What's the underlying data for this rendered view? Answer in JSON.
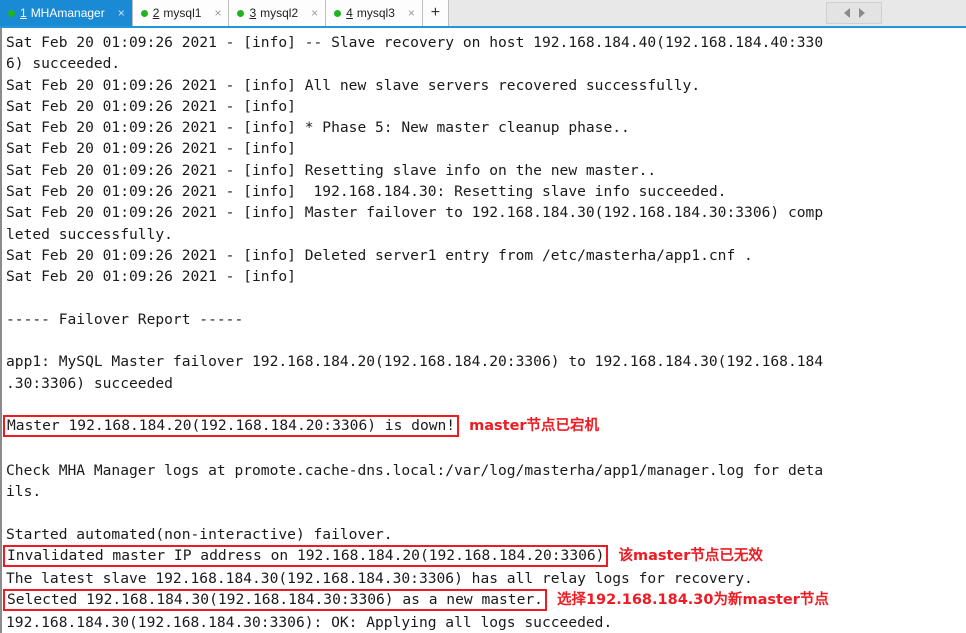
{
  "tabbar": {
    "tabs": [
      {
        "index": "1",
        "label": "MHAmanager",
        "status_color": "#22b321",
        "close": "×",
        "active": true
      },
      {
        "index": "2",
        "label": "mysql1",
        "status_color": "#22b321",
        "close": "×",
        "active": false
      },
      {
        "index": "3",
        "label": "mysql2",
        "status_color": "#22b321",
        "close": "×",
        "active": false
      },
      {
        "index": "4",
        "label": "mysql3",
        "status_color": "#22b321",
        "close": "×",
        "active": false
      }
    ],
    "new_tab_label": "+",
    "nav_prev": "◀",
    "nav_next": "▶"
  },
  "terminal": {
    "lines": [
      {
        "text": "Sat Feb 20 01:09:26 2021 - [info] -- Slave recovery on host 192.168.184.40(192.168.184.40:330"
      },
      {
        "text": "6) succeeded."
      },
      {
        "text": "Sat Feb 20 01:09:26 2021 - [info] All new slave servers recovered successfully."
      },
      {
        "text": "Sat Feb 20 01:09:26 2021 - [info]"
      },
      {
        "text": "Sat Feb 20 01:09:26 2021 - [info] * Phase 5: New master cleanup phase.."
      },
      {
        "text": "Sat Feb 20 01:09:26 2021 - [info]"
      },
      {
        "text": "Sat Feb 20 01:09:26 2021 - [info] Resetting slave info on the new master.."
      },
      {
        "text": "Sat Feb 20 01:09:26 2021 - [info]  192.168.184.30: Resetting slave info succeeded."
      },
      {
        "text": "Sat Feb 20 01:09:26 2021 - [info] Master failover to 192.168.184.30(192.168.184.30:3306) comp"
      },
      {
        "text": "leted successfully."
      },
      {
        "text": "Sat Feb 20 01:09:26 2021 - [info] Deleted server1 entry from /etc/masterha/app1.cnf ."
      },
      {
        "text": "Sat Feb 20 01:09:26 2021 - [info]"
      },
      {
        "text": ""
      },
      {
        "text": "----- Failover Report -----"
      },
      {
        "text": ""
      },
      {
        "text": "app1: MySQL Master failover 192.168.184.20(192.168.184.20:3306) to 192.168.184.30(192.168.184"
      },
      {
        "text": ".30:3306) succeeded"
      },
      {
        "text": ""
      },
      {
        "text": "Master 192.168.184.20(192.168.184.20:3306) is down!",
        "boxed": true,
        "annotation": "master节点已宕机"
      },
      {
        "text": ""
      },
      {
        "text": "Check MHA Manager logs at promote.cache-dns.local:/var/log/masterha/app1/manager.log for deta"
      },
      {
        "text": "ils."
      },
      {
        "text": ""
      },
      {
        "text": "Started automated(non-interactive) failover."
      },
      {
        "text": "Invalidated master IP address on 192.168.184.20(192.168.184.20:3306)",
        "boxed": true,
        "annotation": "该master节点已无效"
      },
      {
        "text": "The latest slave 192.168.184.30(192.168.184.30:3306) has all relay logs for recovery."
      },
      {
        "text": "Selected 192.168.184.30(192.168.184.30:3306) as a new master.",
        "boxed": true,
        "annotation": "选择192.168.184.30为新master节点"
      },
      {
        "text": "192.168.184.30(192.168.184.30:3306): OK: Applying all logs succeeded."
      }
    ],
    "colors": {
      "text": "#1a1a1a",
      "background": "#ffffff",
      "highlight_border": "#ee1b22",
      "annotation": "#ee1b22"
    }
  }
}
